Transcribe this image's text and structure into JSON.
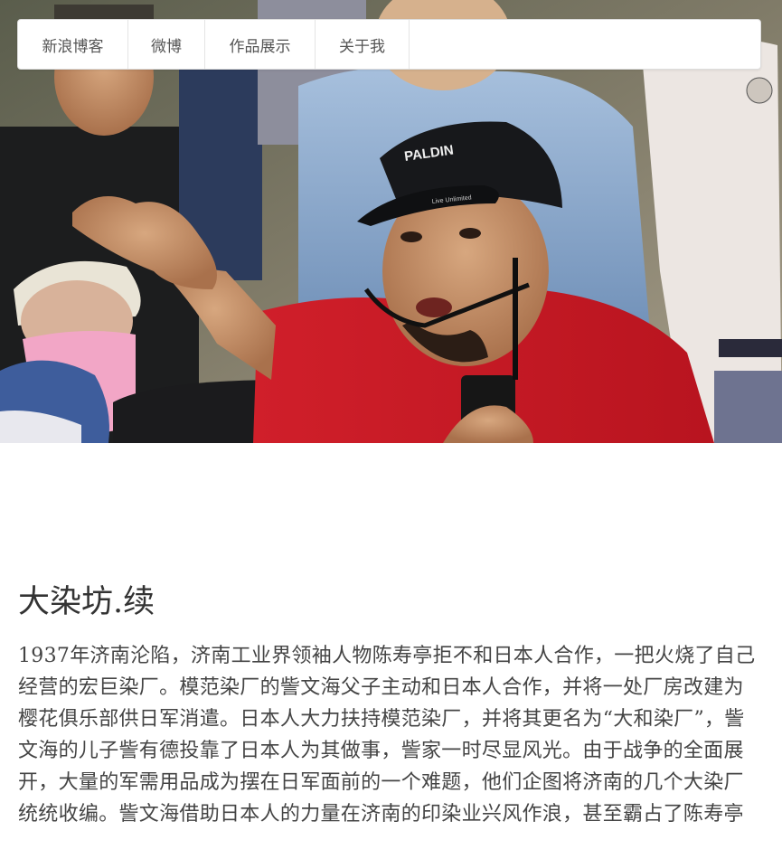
{
  "nav": {
    "items": [
      {
        "label": "新浪博客"
      },
      {
        "label": "微博"
      },
      {
        "label": "作品展示"
      },
      {
        "label": "关于我"
      }
    ]
  },
  "hero": {
    "cap_text": "PALDIN",
    "cap_visor_text": "Live Unlimited"
  },
  "article": {
    "title": "大染坊.续",
    "body": "1937年济南沦陷，济南工业界领袖人物陈寿亭拒不和日本人合作，一把火烧了自己经营的宏巨染厂。模范染厂的訾文海父子主动和日本人合作，并将一处厂房改建为樱花俱乐部供日军消遣。日本人大力扶持模范染厂，并将其更名为“大和染厂”，訾文海的儿子訾有德投靠了日本人为其做事，訾家一时尽显风光。由于战争的全面展开，大量的军需用品成为摆在日军面前的一个难题，他们企图将济南的几个大染厂统统收编。訾文海借助日本人的力量在济南的印染业兴风作浪，甚至霸占了陈寿亭"
  }
}
